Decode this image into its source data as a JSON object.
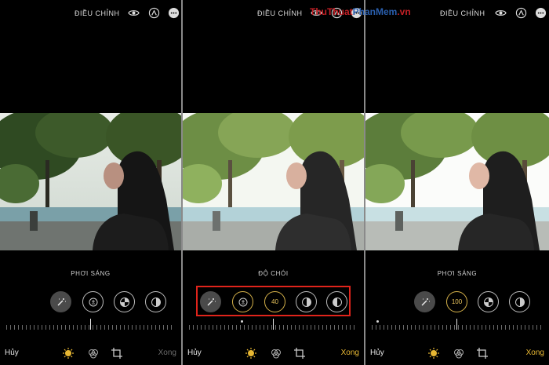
{
  "panels": [
    {
      "title": "ĐIỀU CHỈNH",
      "adjust_label": "PHƠI SÁNG",
      "cancel": "Hủy",
      "done": "Xong"
    },
    {
      "title": "ĐIỀU CHỈNH",
      "adjust_label": "ĐỘ CHÓI",
      "cancel": "Hủy",
      "done": "Xong",
      "brilliance_value": "40"
    },
    {
      "title": "ĐIỀU CHỈNH",
      "adjust_label": "PHƠI SÁNG",
      "cancel": "Hủy",
      "done": "Xong",
      "exposure_value": "100"
    }
  ],
  "watermark": {
    "part1": "ThuThuat",
    "part2": "PhanMem",
    "part3": ".vn"
  },
  "colors": {
    "accent": "#e7b733",
    "highlight_box": "#e0241b"
  }
}
